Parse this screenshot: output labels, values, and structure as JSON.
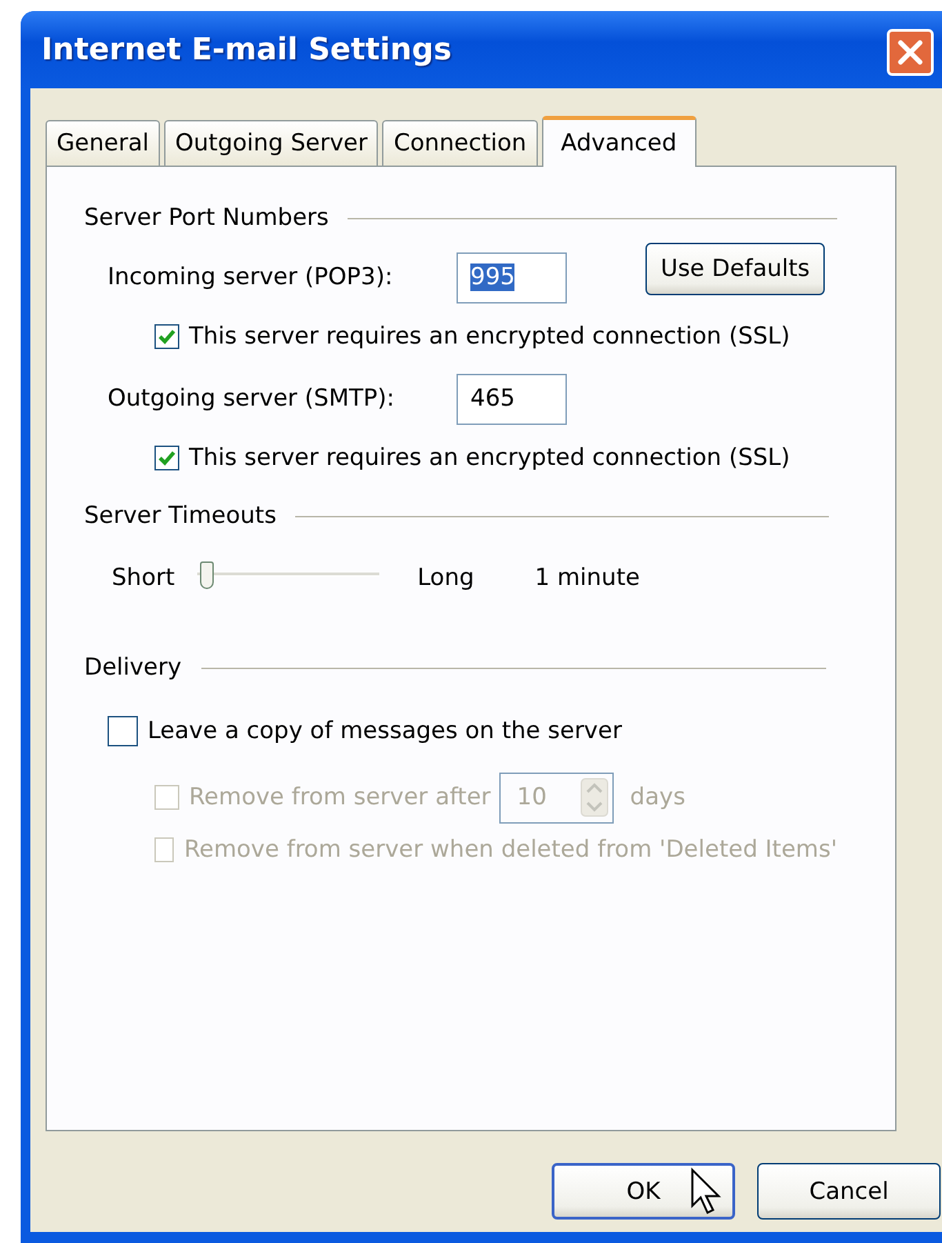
{
  "window": {
    "title": "Internet E-mail Settings"
  },
  "tabs": [
    {
      "label": "General",
      "selected": false
    },
    {
      "label": "Outgoing Server",
      "selected": false
    },
    {
      "label": "Connection",
      "selected": false
    },
    {
      "label": "Advanced",
      "selected": true
    }
  ],
  "server_ports": {
    "heading": "Server Port Numbers",
    "use_defaults_button": "Use Defaults",
    "incoming": {
      "label": "Incoming server (POP3):",
      "value": "995",
      "text_selected": true
    },
    "incoming_ssl": {
      "label": "This server requires an encrypted connection (SSL)",
      "checked": true
    },
    "outgoing": {
      "label": "Outgoing server (SMTP):",
      "value": "465",
      "text_selected": false
    },
    "outgoing_ssl": {
      "label": "This server requires an encrypted connection (SSL)",
      "checked": true
    }
  },
  "timeouts": {
    "heading": "Server Timeouts",
    "min_label": "Short",
    "max_label": "Long",
    "level": 0.05,
    "reading": "1 minute"
  },
  "delivery": {
    "heading": "Delivery",
    "leave_copy": {
      "label": "Leave a copy of messages on the server",
      "checked": false,
      "disabled": false
    },
    "remove_after": {
      "label": "Remove from server after",
      "checked": false,
      "disabled": true,
      "value": "10",
      "unit": "days"
    },
    "remove_deleted": {
      "label": "Remove from server when deleted from 'Deleted Items'",
      "checked": false,
      "disabled": true
    }
  },
  "buttons": [
    {
      "label": "OK",
      "default": true
    },
    {
      "label": "Cancel",
      "default": false
    }
  ]
}
